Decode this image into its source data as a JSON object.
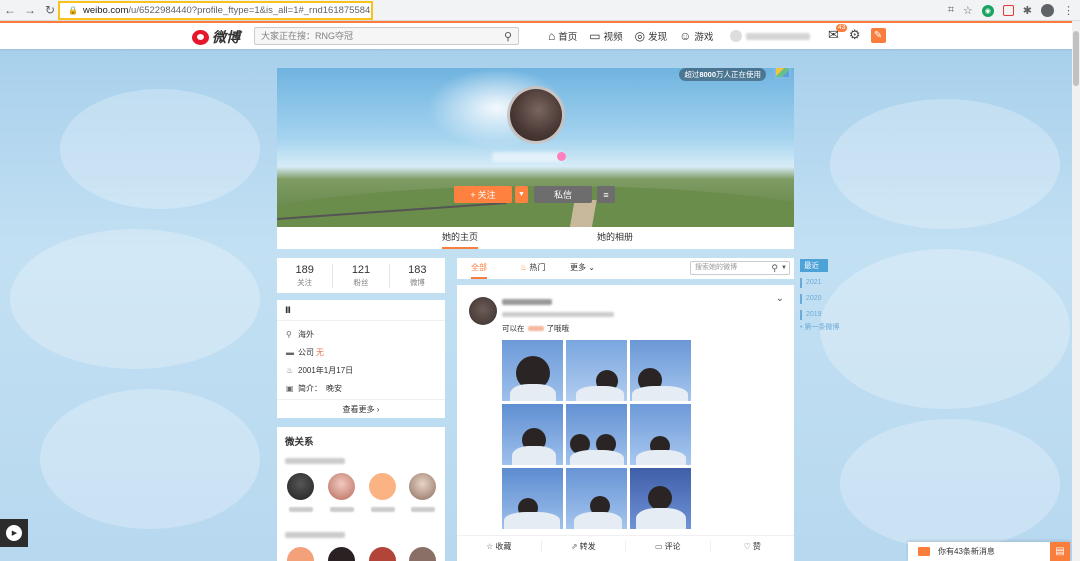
{
  "browser": {
    "url_host": "weibo.com",
    "url_rest": "/u/6522984440?profile_ftype=1&is_all=1#_rnd1618755842583"
  },
  "topnav": {
    "logo_text": "微博",
    "search_placeholder": "大家正在搜：RNG夺冠",
    "items": [
      {
        "label": "首页"
      },
      {
        "label": "视频"
      },
      {
        "label": "发现"
      },
      {
        "label": "游戏"
      }
    ],
    "mail_badge": "43"
  },
  "cover": {
    "users_badge_prefix": "超过",
    "users_badge_number": "8000",
    "users_badge_suffix": "万人正在使用",
    "follow_label": "关注",
    "message_label": "私信"
  },
  "profile_tabs": [
    {
      "label": "她的主页",
      "active": true
    },
    {
      "label": "她的相册",
      "active": false
    }
  ],
  "stats": [
    {
      "value": "189",
      "label": "关注"
    },
    {
      "value": "121",
      "label": "粉丝"
    },
    {
      "value": "183",
      "label": "微博"
    }
  ],
  "info": {
    "header": "Ⅱ",
    "location": "海外",
    "company_label": "公司",
    "company_value": "无",
    "birthday": "2001年1月17日",
    "bio_label": "简介：",
    "bio_value": "晚安",
    "more_label": "查看更多 ›"
  },
  "relations": {
    "title": "微关系"
  },
  "feed": {
    "tabs": [
      {
        "label": "全部"
      },
      {
        "label": "热门"
      },
      {
        "label": "更多"
      }
    ],
    "search_placeholder": "搜索她的微博",
    "post_text_prefix": "可以在",
    "post_text_suffix": "了哦哦",
    "actions": [
      {
        "label": "收藏"
      },
      {
        "label": "转发"
      },
      {
        "label": "评论"
      },
      {
        "label": "赞"
      }
    ]
  },
  "timeline": {
    "active": "最近",
    "years": [
      "2021",
      "2020",
      "2019"
    ],
    "first": "• 第一条微博"
  },
  "notification": {
    "text": "你有43条新消息"
  },
  "colors": {
    "accent": "#fa7d3c",
    "brand_red": "#e6162d",
    "timeline_blue": "#4da2d8"
  }
}
